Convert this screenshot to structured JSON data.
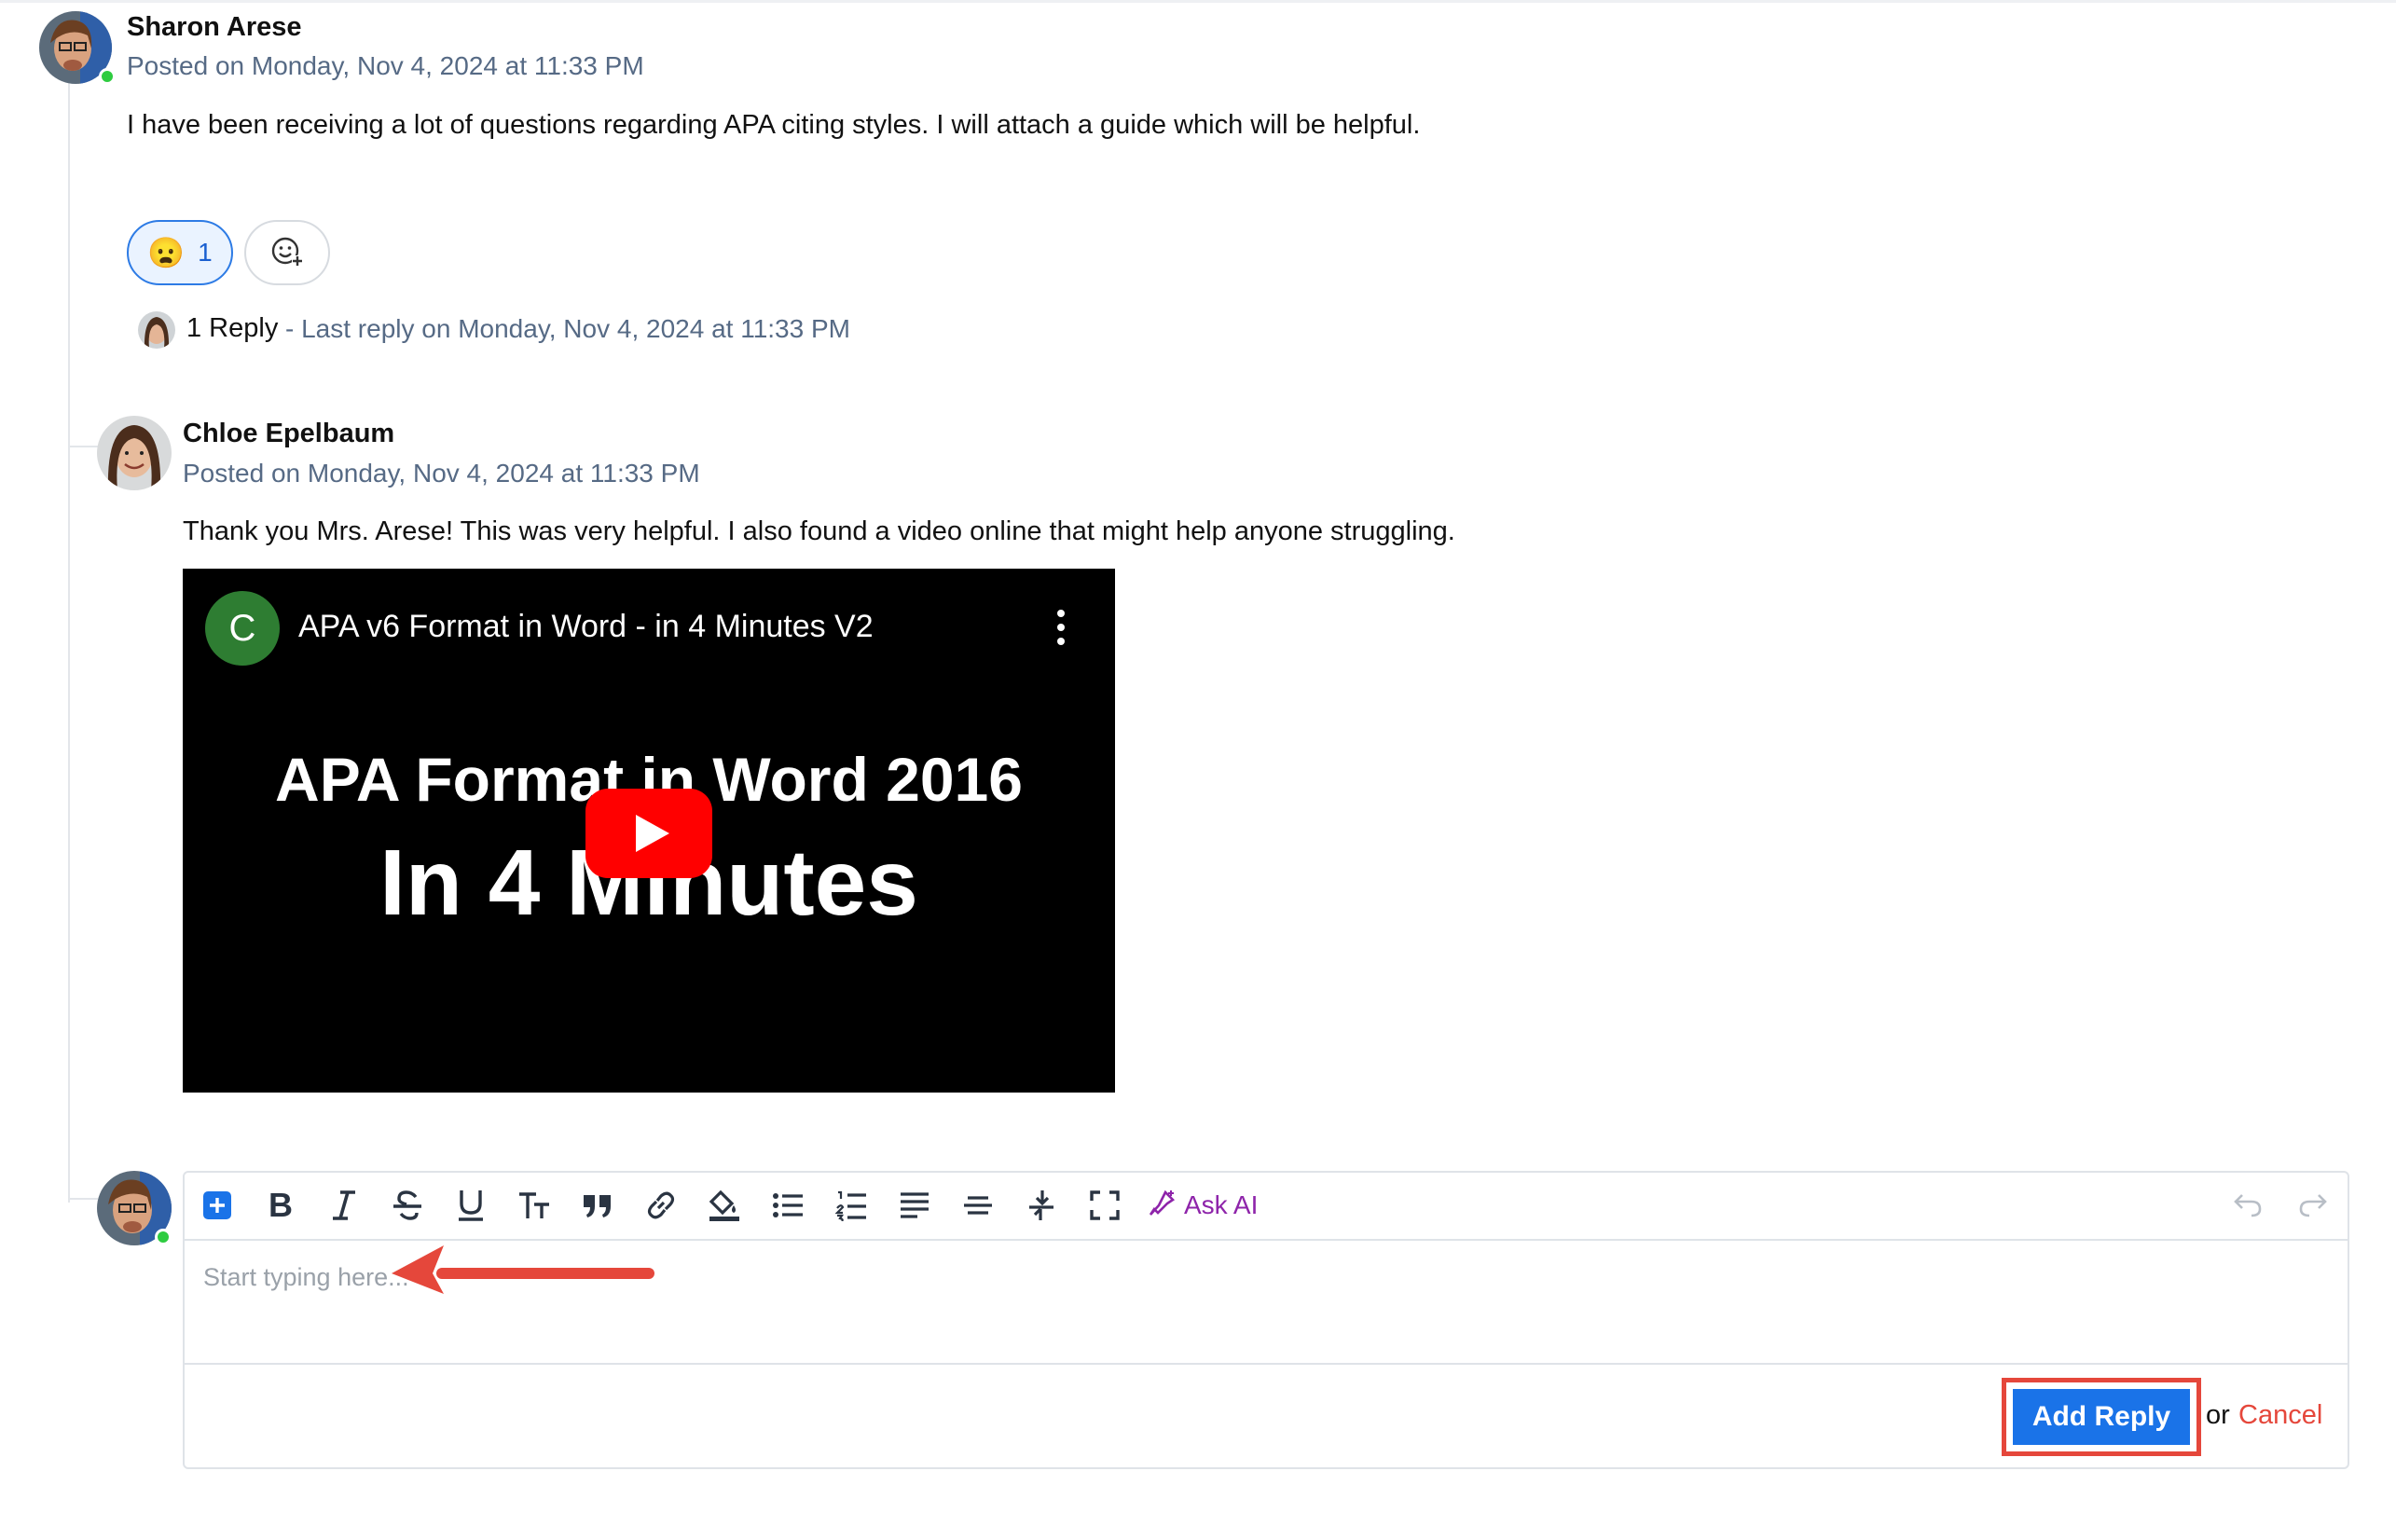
{
  "post": {
    "author": "Sharon Arese",
    "posted": "Posted on Monday, Nov 4, 2024 at 11:33 PM",
    "body": "I have been receiving a lot of questions regarding APA citing styles. I will attach a guide which will be helpful.",
    "reaction": {
      "emoji": "😦",
      "count": "1"
    },
    "replies": {
      "count_label": "1 Reply",
      "last_reply": "- Last reply on Monday, Nov 4, 2024 at 11:33 PM"
    }
  },
  "reply": {
    "author": "Chloe Epelbaum",
    "posted": "Posted on Monday, Nov 4, 2024 at 11:33 PM",
    "body": "Thank you Mrs. Arese! This was very helpful. I also found a video online that might help anyone struggling.",
    "video": {
      "channel_initial": "C",
      "title": "APA v6 Format in Word - in 4 Minutes V2",
      "thumb_line1": "APA Format in Word 2016",
      "thumb_line2": "In 4 Minutes"
    }
  },
  "editor": {
    "placeholder": "Start typing here...",
    "ask_ai_label": "Ask AI",
    "submit_label": "Add Reply",
    "or_label": "or",
    "cancel_label": "Cancel",
    "toolbar": [
      "plus-icon",
      "bold-icon",
      "italic-icon",
      "strikethrough-icon",
      "underline-icon",
      "text-size-icon",
      "quote-icon",
      "link-icon",
      "highlight-icon",
      "bullet-list-icon",
      "numbered-list-icon",
      "align-icon",
      "horizontal-rule-icon",
      "tools-icon",
      "fullscreen-icon",
      "ask-ai-icon",
      "undo-icon",
      "redo-icon"
    ]
  },
  "colors": {
    "accent": "#1a73e8",
    "cancel": "#e5473b",
    "meta": "#566a85",
    "highlight": "#e5473b",
    "youtube": "#ff0000"
  }
}
